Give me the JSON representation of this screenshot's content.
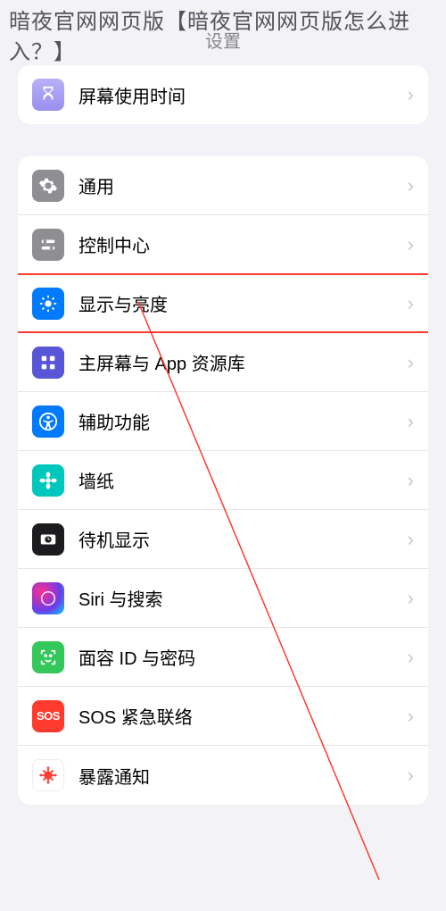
{
  "overlay_text": "暗夜官网网页版【暗夜官网网页版怎么进入？】",
  "header_title": "设置",
  "group1": {
    "items": [
      {
        "label": "屏幕使用时间",
        "icon": "hourglass-icon"
      }
    ]
  },
  "group2": {
    "items": [
      {
        "label": "通用",
        "icon": "gear-icon"
      },
      {
        "label": "控制中心",
        "icon": "toggles-icon"
      },
      {
        "label": "显示与亮度",
        "icon": "brightness-icon",
        "highlighted": true
      },
      {
        "label": "主屏幕与 App 资源库",
        "icon": "apps-grid-icon"
      },
      {
        "label": "辅助功能",
        "icon": "accessibility-icon"
      },
      {
        "label": "墙纸",
        "icon": "flower-icon"
      },
      {
        "label": "待机显示",
        "icon": "clock-icon"
      },
      {
        "label": "Siri 与搜索",
        "icon": "siri-icon"
      },
      {
        "label": "面容 ID 与密码",
        "icon": "faceid-icon"
      },
      {
        "label": "SOS 紧急联络",
        "icon": "sos-icon",
        "icon_text": "SOS"
      },
      {
        "label": "暴露通知",
        "icon": "virus-icon"
      }
    ]
  }
}
